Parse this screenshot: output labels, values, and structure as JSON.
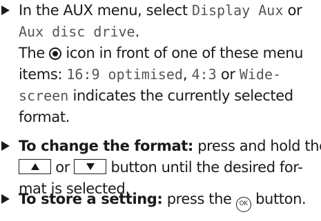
{
  "instructions": {
    "step1": {
      "line1_prefix": "In the AUX menu, select ",
      "option_display_aux": "Display Aux",
      "line1_or": " or",
      "option_aux_disc_drive": "Aux disc drive",
      "line2_end": ".",
      "line3_the": "The ",
      "line3_rest": " icon in front of one of these menu",
      "line4_items": "items: ",
      "format_16_9": "16:9 optimised",
      "sep_comma": ", ",
      "format_4_3": "4:3",
      "sep_or": " or ",
      "format_wide_part1": "Wide-",
      "format_wide_part2": "screen",
      "line5_rest": " indicates the currently selected",
      "line6": "format."
    },
    "step2": {
      "bold": "To change the format:",
      "line1_rest": " press and hold the",
      "between_keys": " or ",
      "line2_rest": " button until the desired for-",
      "line3": "mat is selected."
    },
    "step3": {
      "bold": "To store a setting:",
      "rest_before": " press the ",
      "ok_label": "OK",
      "rest_after": " button."
    },
    "icons": {
      "step_marker": "right-triangle-icon",
      "selected_indicator": "radio-selected-icon",
      "up_key": "up-arrow-key-icon",
      "down_key": "down-arrow-key-icon",
      "ok_button": "ok-button-icon"
    }
  }
}
